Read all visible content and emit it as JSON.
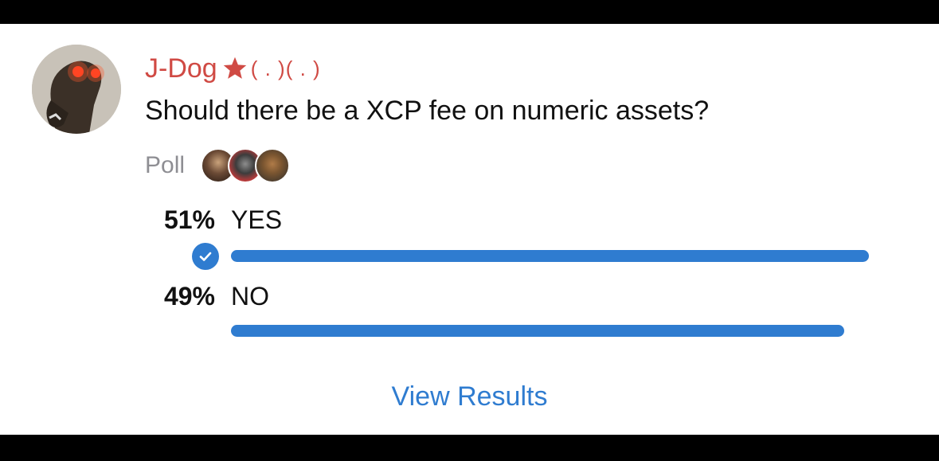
{
  "post": {
    "author_name": "J-Dog",
    "author_emoticon": "( . )( . )",
    "question": "Should there be a XCP fee on numeric assets?"
  },
  "poll": {
    "label": "Poll",
    "options": [
      {
        "percent_text": "51%",
        "label": "YES",
        "fraction": 0.51,
        "selected": true
      },
      {
        "percent_text": "49%",
        "label": "NO",
        "fraction": 0.49,
        "selected": false
      }
    ],
    "view_results_label": "View Results"
  },
  "colors": {
    "accent": "#2f7cd0",
    "author": "#d04a44",
    "muted": "#8e8e93"
  },
  "icons": {
    "avatar": "horse-head-avatar",
    "star": "star-icon",
    "check": "check-circle-icon"
  }
}
